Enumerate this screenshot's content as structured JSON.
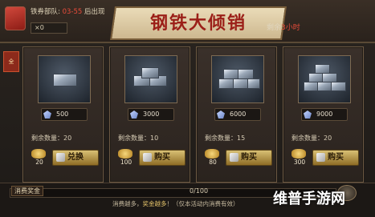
{
  "header": {
    "crystal_label": "",
    "subtitle_prefix": "铁券部队:",
    "subtitle_time": "03-55",
    "subtitle_suffix": "后出现",
    "count_text": "×0",
    "banner_title": "钢铁大倾销",
    "remain_prefix": "剩余",
    "remain_value": "3小时"
  },
  "side_tag": "全",
  "cards": [
    {
      "price": "500",
      "stock_label": "剩余数量：20",
      "cost": "20",
      "button": "兑换"
    },
    {
      "price": "3000",
      "stock_label": "剩余数量：10",
      "cost": "100",
      "button": "购买"
    },
    {
      "price": "6000",
      "stock_label": "剩余数量：15",
      "cost": "80",
      "button": "购买"
    },
    {
      "price": "9000",
      "stock_label": "剩余数量：20",
      "cost": "300",
      "button": "购买"
    }
  ],
  "bottom": {
    "progress_label": "消费奖金",
    "progress_value": "0/100",
    "progress_fraction": 0,
    "message_prefix": "消费越多，",
    "message_highlight": "奖金越多",
    "message_suffix": "！（仅本活动内消费有效）"
  },
  "watermark": "维普手游网",
  "colors": {
    "accent_red": "#e84b3a",
    "banner_text": "#9b1f18",
    "button_gold": "#d8c074"
  }
}
